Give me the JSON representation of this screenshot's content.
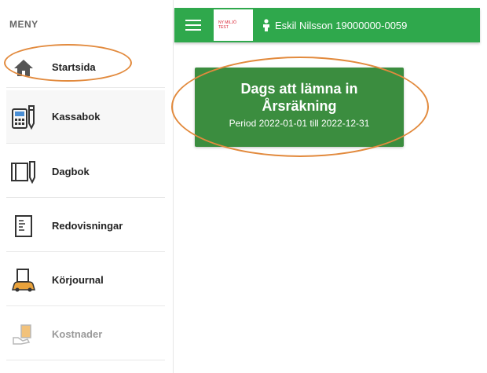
{
  "sidebar": {
    "title": "MENY",
    "items": [
      {
        "label": "Startsida",
        "icon": "home-icon"
      },
      {
        "label": "Kassabok",
        "icon": "calculator-pen-icon"
      },
      {
        "label": "Dagbok",
        "icon": "notebook-pen-icon"
      },
      {
        "label": "Redovisningar",
        "icon": "document-list-icon"
      },
      {
        "label": "Körjournal",
        "icon": "car-log-icon"
      },
      {
        "label": "Kostnader",
        "icon": "receipt-hand-icon"
      }
    ]
  },
  "header": {
    "logo_line1": "NY MILJÖ",
    "logo_line2": "TEST",
    "user": "Eskil Nilsson 19000000-0059"
  },
  "promo": {
    "line1": "Dags att lämna in",
    "line2": "Årsräkning",
    "period": "Period 2022-01-01 till 2022-12-31"
  },
  "colors": {
    "header_green": "#2fa84c",
    "card_green": "#3b8d3f",
    "annotation_orange": "#e28a3d"
  }
}
